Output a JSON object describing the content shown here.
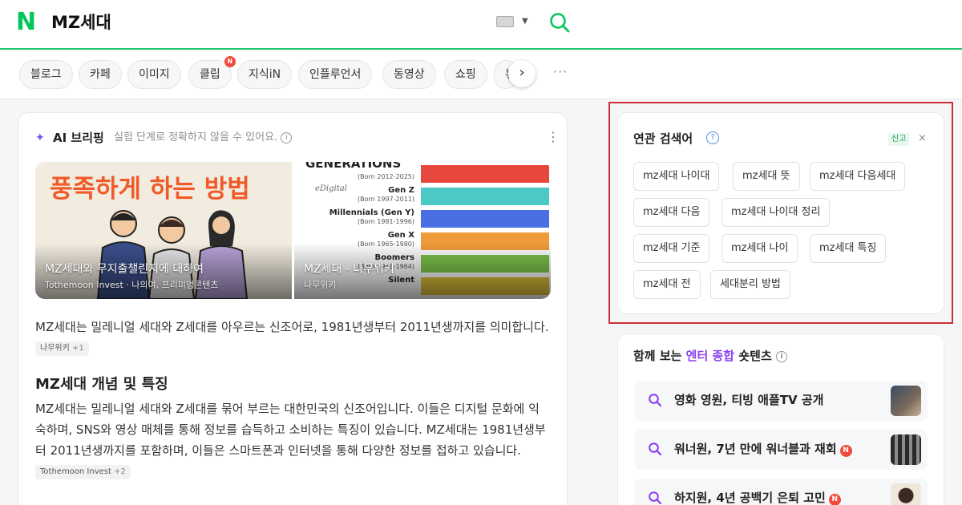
{
  "header": {
    "query": "MZ세대",
    "logo_letter": "N",
    "colors": {
      "brand": "#03c75a",
      "highlight_border": "#cc2f35"
    }
  },
  "tabs": [
    {
      "label": "블로그"
    },
    {
      "label": "카페"
    },
    {
      "label": "이미지"
    },
    {
      "label": "클립",
      "badge": "N"
    },
    {
      "label": "지식iN"
    },
    {
      "label": "인플루언서"
    },
    {
      "label": "동영상"
    },
    {
      "label": "쇼핑"
    },
    {
      "label": "뉴"
    }
  ],
  "tab_controls": {
    "next": "›",
    "more": "···"
  },
  "ai_briefing": {
    "title": "AI 브리핑",
    "note": "실험 단계로 정확하지 않을 수 있어요.",
    "images": [
      {
        "headline": "풍족하게 하는 방법",
        "title": "MZ세대와 무지출챌린지에 대하여",
        "source": "Tothemoon Invest · 나의여, 프리미엄콘텐츠"
      },
      {
        "title": "MZ세대 - 나무위키",
        "source": "나무위키"
      }
    ],
    "generations_chart": {
      "heading": "GENERATIONS",
      "brand": "eDigital",
      "rows": [
        {
          "name": "",
          "years": "(Born 2012-2025)",
          "color": "#e8473e"
        },
        {
          "name": "Gen Z",
          "years": "(Born 1997-2011)",
          "color": "#4cc9c7"
        },
        {
          "name": "Millennials (Gen Y)",
          "years": "(Born 1981-1996)",
          "color": "#4a6fe3"
        },
        {
          "name": "Gen X",
          "years": "(Born 1965-1980)",
          "color": "#ef9a3a"
        },
        {
          "name": "Boomers",
          "years": "(Born 1946-1964)",
          "color": "#7cc34a"
        },
        {
          "name": "Silent",
          "years": "",
          "color": "#e0c23a"
        }
      ]
    },
    "paragraph1": "MZ세대는 밀레니얼 세대와 Z세대를 아우르는 신조어로, 1981년생부터 2011년생까지를 의미합니다.",
    "paragraph1_source": {
      "name": "나무위키",
      "more": "+1"
    },
    "heading2": "MZ세대 개념 및 특징",
    "paragraph2": "MZ세대는 밀레니얼 세대와 Z세대를 묶어 부르는 대한민국의 신조어입니다. 이들은 디지털 문화에 익숙하며, SNS와 영상 매체를 통해 정보를 습득하고 소비하는 특징이 있습니다. MZ세대는 1981년생부터 2011년생까지를 포함하며, 이들은 스마트폰과 인터넷을 통해 다양한 정보를 접하고 있습니다.",
    "paragraph2_source": {
      "name": "Tothemoon Invest",
      "more": "+2"
    }
  },
  "related": {
    "title": "연관 검색어",
    "report": "신고",
    "close": "×",
    "chips": [
      "mz세대 나이대",
      "mz세대 뜻",
      "mz세대 다음세대",
      "mz세대 다음",
      "mz세대 나이대 정리",
      "mz세대 기준",
      "mz세대 나이",
      "mz세대 특징",
      "mz세대 전",
      "세대분리 방법"
    ]
  },
  "shortents": {
    "title_prefix": "함께 보는",
    "title_accent": "엔터 종합",
    "title_suffix": "숏텐츠",
    "items": [
      {
        "label": "영화 영원, 티빙 애플TV 공개",
        "new": false
      },
      {
        "label": "워너원, 7년 만에 워너블과 재회",
        "new": true
      },
      {
        "label": "하지원, 4년 공백기 은퇴 고민",
        "new": true
      }
    ]
  }
}
